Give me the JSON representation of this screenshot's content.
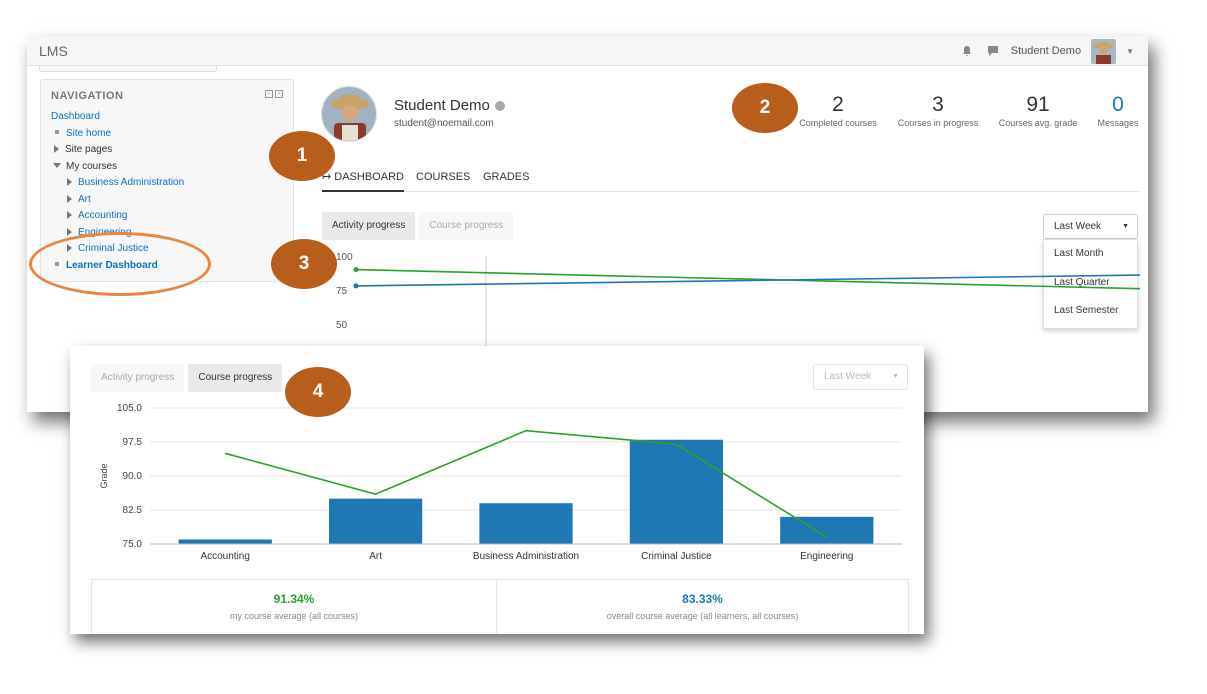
{
  "app": {
    "title": "LMS",
    "user_name": "Student Demo"
  },
  "navigation": {
    "title": "NAVIGATION",
    "items": [
      {
        "label": "Dashboard",
        "kind": "link"
      },
      {
        "label": "Site home",
        "kind": "bullet-link"
      },
      {
        "label": "Site pages",
        "kind": "collapsed"
      },
      {
        "label": "My courses",
        "kind": "expanded"
      },
      {
        "label": "Business Administration",
        "kind": "course"
      },
      {
        "label": "Art",
        "kind": "course"
      },
      {
        "label": "Accounting",
        "kind": "course"
      },
      {
        "label": "Engineering",
        "kind": "course"
      },
      {
        "label": "Criminal Justice",
        "kind": "course"
      },
      {
        "label": "Learner Dashboard",
        "kind": "current"
      }
    ]
  },
  "profile": {
    "name": "Student Demo",
    "email": "student@noemail.com"
  },
  "stats": [
    {
      "value": "2",
      "label": "Completed courses"
    },
    {
      "value": "3",
      "label": "Courses in progress"
    },
    {
      "value": "91",
      "label": "Courses avg. grade"
    },
    {
      "value": "0",
      "label": "Messages"
    }
  ],
  "tabs": [
    {
      "label": "DASHBOARD",
      "active": true
    },
    {
      "label": "COURSES",
      "active": false
    },
    {
      "label": "GRADES",
      "active": false
    }
  ],
  "progress_buttons": {
    "activity": "Activity progress",
    "course": "Course progress"
  },
  "period_select": {
    "selected": "Last Week",
    "options": [
      "Last Month",
      "Last Quarter",
      "Last Semester"
    ]
  },
  "chart_data": [
    {
      "type": "line",
      "y_ticks": [
        "100",
        "75",
        "50"
      ],
      "ylim": [
        0,
        100
      ],
      "series": [
        {
          "color": "#2ca02c",
          "points": [
            [
              0,
              90
            ],
            [
              1,
              76
            ]
          ]
        },
        {
          "color": "#1f77b4",
          "points": [
            [
              0,
              78
            ],
            [
              1,
              86
            ]
          ]
        }
      ]
    },
    {
      "type": "bar",
      "ylabel": "Grade",
      "ylim": [
        75,
        105
      ],
      "y_ticks": [
        "105.0",
        "97.5",
        "90.0",
        "82.5",
        "75.0"
      ],
      "categories": [
        "Accounting",
        "Art",
        "Business Administration",
        "Criminal Justice",
        "Engineering"
      ],
      "bar_values": [
        76,
        85,
        84,
        98,
        81
      ],
      "line_values": [
        95,
        86,
        100,
        97,
        76.5
      ],
      "bar_color": "#1f78b4",
      "line_color": "#2ca02c"
    }
  ],
  "averages": {
    "my": {
      "value": "91.34%",
      "label": "my course average (all courses)",
      "color": "#2ca02c"
    },
    "overall": {
      "value": "83.33%",
      "label": "overall course average (all learners, all courses)",
      "color": "#1f78b4"
    }
  },
  "annotations": [
    "1",
    "2",
    "3",
    "4"
  ]
}
